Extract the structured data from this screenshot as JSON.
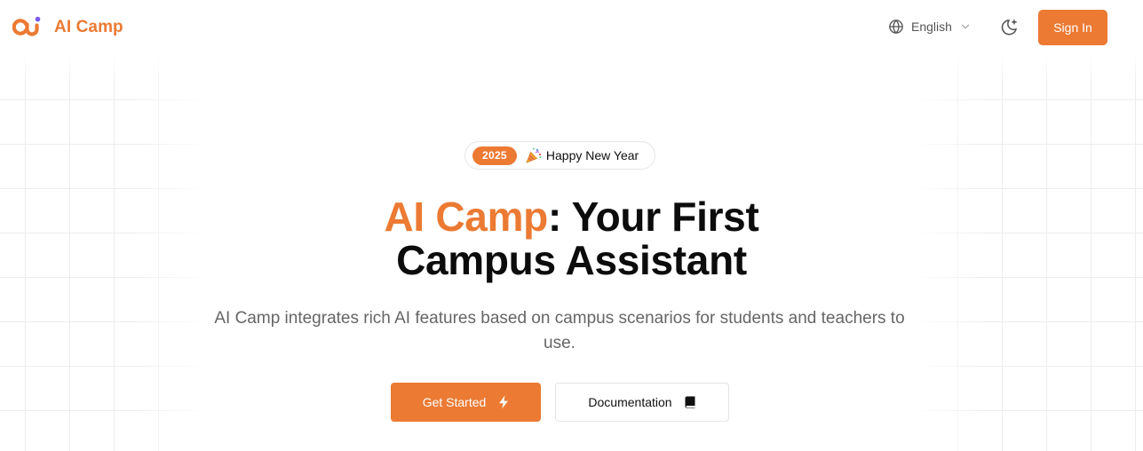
{
  "header": {
    "brand_name": "AI Camp",
    "logo_icon": "ai-camp-logo",
    "language": {
      "icon": "globe-icon",
      "selected": "English",
      "chevron_icon": "chevron-down-icon"
    },
    "theme_toggle_icon": "moon-sparkle-icon",
    "sign_in_label": "Sign In"
  },
  "hero": {
    "announcement": {
      "badge": "2025",
      "emoji_icon": "party-popper-icon",
      "text": "Happy New Year"
    },
    "headline": {
      "accent": "AI Camp",
      "rest_line1": ": Your First",
      "line2": "Campus Assistant"
    },
    "subtitle": "AI Camp integrates rich AI features based on campus scenarios for students and teachers to use.",
    "primary_cta": {
      "label": "Get Started",
      "icon": "lightning-bolt-icon"
    },
    "secondary_cta": {
      "label": "Documentation",
      "icon": "book-icon"
    }
  },
  "colors": {
    "accent": "#ec7a33",
    "text": "#0c0c0c",
    "muted": "#666666",
    "grid_line": "#ededed"
  }
}
